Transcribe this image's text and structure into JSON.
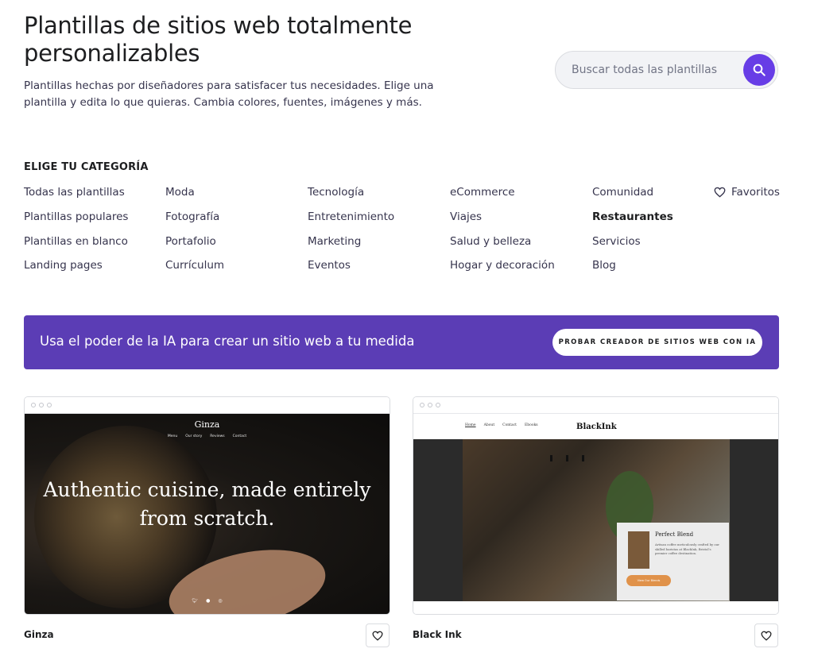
{
  "hero": {
    "title": "Plantillas de sitios web totalmente personalizables",
    "subtitle": "Plantillas hechas por diseñadores para satisfacer tus necesidades. Elige una plantilla y edita lo que quieras. Cambia colores, fuentes, imágenes y más."
  },
  "search": {
    "placeholder": "Buscar todas las plantillas"
  },
  "categories": {
    "heading": "ELIGE TU CATEGORÍA",
    "col1": [
      "Todas las plantillas",
      "Plantillas populares",
      "Plantillas en blanco",
      "Landing pages"
    ],
    "col2": [
      "Moda",
      "Fotografía",
      "Portafolio",
      "Currículum"
    ],
    "col3": [
      "Tecnología",
      "Entretenimiento",
      "Marketing",
      "Eventos"
    ],
    "col4": [
      "eCommerce",
      "Viajes",
      "Salud y belleza",
      "Hogar y decoración"
    ],
    "col5": [
      "Comunidad",
      "Restaurantes",
      "Servicios",
      "Blog"
    ],
    "active": "Restaurantes",
    "favorites_label": "Favoritos"
  },
  "banner": {
    "text": "Usa el poder de la IA para crear un sitio web a tu medida",
    "button": "PROBAR CREADOR DE SITIOS WEB CON IA",
    "color": "#5b3db5"
  },
  "templates": [
    {
      "name": "Ginza",
      "preview": {
        "logo": "Ginza",
        "nav": [
          "Menu",
          "Our story",
          "Reviews",
          "Contact"
        ],
        "headline": "Authentic cuisine, made entirely from scratch.",
        "social_icons": [
          "twitter-icon",
          "facebook-icon",
          "instagram-icon"
        ]
      }
    },
    {
      "name": "Black Ink",
      "preview": {
        "logo": "BlackInk",
        "nav": [
          "Home",
          "About",
          "Contact",
          "Ebooks"
        ],
        "panel_title": "Perfect Blend",
        "panel_text": "Artisan coffee meticulously crafted by our skilled baristas at BlackInk, Bristol's premier coffee destination.",
        "panel_button": "View Our Blends"
      }
    }
  ],
  "colors": {
    "accent": "#673de6",
    "text": "#1d1e20",
    "muted": "#36344d"
  }
}
